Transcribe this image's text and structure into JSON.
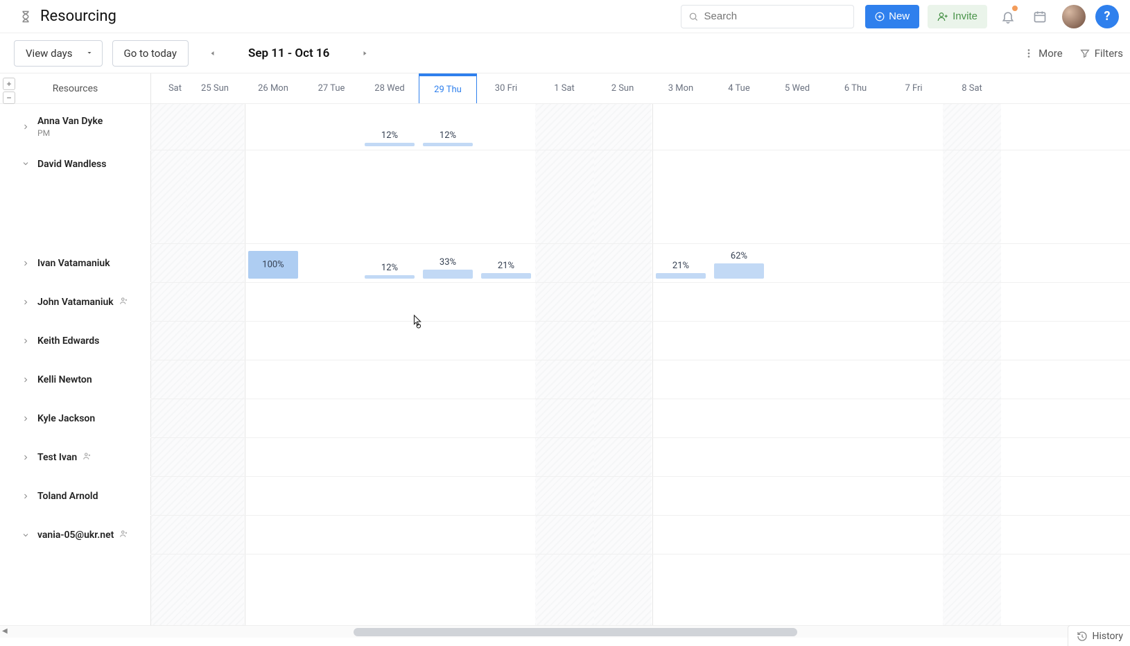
{
  "header": {
    "page_title": "Resourcing",
    "search_placeholder": "Search",
    "new_button": "New",
    "invite_button": "Invite",
    "help_label": "?"
  },
  "toolbar": {
    "view_mode": "View days",
    "go_today": "Go to today",
    "date_range": "Sep 11 - Oct 16",
    "more_label": "More",
    "filters_label": "Filters"
  },
  "side": {
    "column_title": "Resources"
  },
  "days": [
    {
      "label": "Sat",
      "kind": "first weekend"
    },
    {
      "label": "25 Sun",
      "kind": "weekend"
    },
    {
      "label": "26 Mon",
      "kind": "wkstart"
    },
    {
      "label": "27 Tue",
      "kind": ""
    },
    {
      "label": "28 Wed",
      "kind": ""
    },
    {
      "label": "29 Thu",
      "kind": "today"
    },
    {
      "label": "30 Fri",
      "kind": ""
    },
    {
      "label": "1 Sat",
      "kind": "weekend"
    },
    {
      "label": "2 Sun",
      "kind": "weekend"
    },
    {
      "label": "3 Mon",
      "kind": "wkstart"
    },
    {
      "label": "4 Tue",
      "kind": ""
    },
    {
      "label": "5 Wed",
      "kind": ""
    },
    {
      "label": "6 Thu",
      "kind": ""
    },
    {
      "label": "7 Fri",
      "kind": ""
    },
    {
      "label": "8 Sat",
      "kind": "weekend"
    }
  ],
  "resources": [
    {
      "name": "Anna Van Dyke",
      "sub": "PM",
      "expanded": false,
      "height": "short",
      "util": [
        {
          "day": 4,
          "pct": "12%",
          "fill": 0.12
        },
        {
          "day": 5,
          "pct": "12%",
          "fill": 0.12
        }
      ]
    },
    {
      "name": "David Wandless",
      "sub": "",
      "expanded": true,
      "height": "tall",
      "util": []
    },
    {
      "name": "Ivan Vatamaniuk",
      "sub": "",
      "expanded": false,
      "height": "short",
      "util": [
        {
          "day": 2,
          "pct": "100%",
          "fill": 1.0
        },
        {
          "day": 4,
          "pct": "12%",
          "fill": 0.12
        },
        {
          "day": 5,
          "pct": "33%",
          "fill": 0.33
        },
        {
          "day": 6,
          "pct": "21%",
          "fill": 0.21
        },
        {
          "day": 9,
          "pct": "21%",
          "fill": 0.21
        },
        {
          "day": 10,
          "pct": "62%",
          "fill": 0.62
        }
      ]
    },
    {
      "name": "John Vatamaniuk",
      "sub": "",
      "expanded": false,
      "user_icon": true,
      "height": "short",
      "util": []
    },
    {
      "name": "Keith Edwards",
      "sub": "",
      "expanded": false,
      "height": "short",
      "util": []
    },
    {
      "name": "Kelli Newton",
      "sub": "",
      "expanded": false,
      "height": "short",
      "util": []
    },
    {
      "name": "Kyle Jackson",
      "sub": "",
      "expanded": false,
      "height": "short",
      "util": []
    },
    {
      "name": "Test Ivan",
      "sub": "",
      "expanded": false,
      "user_icon": true,
      "height": "short",
      "util": []
    },
    {
      "name": "Toland Arnold",
      "sub": "",
      "expanded": false,
      "height": "short",
      "util": []
    },
    {
      "name": "vania-05@ukr.net",
      "sub": "",
      "expanded": true,
      "user_icon": true,
      "height": "short",
      "util": []
    }
  ],
  "footer": {
    "history_label": "History"
  }
}
